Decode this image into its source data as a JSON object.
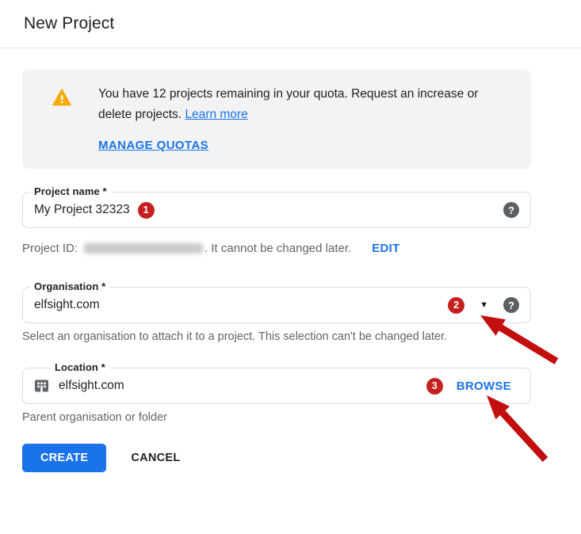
{
  "page": {
    "title": "New Project"
  },
  "quota_notice": {
    "text_before_link": "You have 12 projects remaining in your quota. Request an increase or delete projects. ",
    "learn_more_label": "Learn more",
    "manage_quotas_label": "MANAGE QUOTAS"
  },
  "project_name_field": {
    "label": "Project name *",
    "value": "My Project 32323",
    "badge": "1"
  },
  "project_id_row": {
    "prefix": "Project ID:",
    "suffix": ". It cannot be changed later.",
    "edit_label": "EDIT"
  },
  "organisation_field": {
    "label": "Organisation *",
    "value": "elfsight.com",
    "badge": "2",
    "helper": "Select an organisation to attach it to a project. This selection can't be changed later."
  },
  "location_field": {
    "label": "Location *",
    "value": "elfsight.com",
    "badge": "3",
    "browse_label": "BROWSE",
    "helper": "Parent organisation or folder"
  },
  "actions": {
    "create_label": "CREATE",
    "cancel_label": "CANCEL"
  },
  "icons": {
    "help_glyph": "?",
    "caret_glyph": "▼"
  },
  "colors": {
    "accent_blue": "#1a73e8",
    "badge_red": "#c5221f",
    "arrow_red": "#c20e0e",
    "warning_amber": "#f9ab00",
    "notice_bg": "#f1f3f4",
    "border_gray": "#dadce0",
    "text_primary": "#202124",
    "text_secondary": "#5f6368"
  }
}
